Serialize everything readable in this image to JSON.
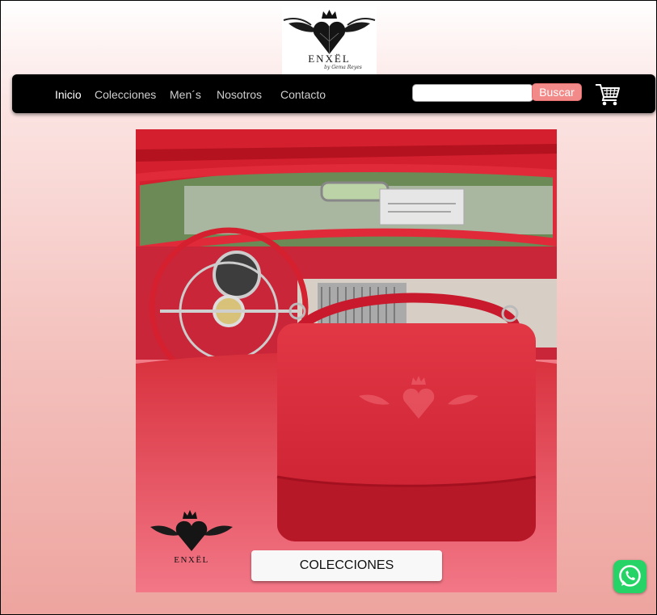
{
  "brand": {
    "name": "ENXËL",
    "signature": "by Gema Reyes"
  },
  "nav": {
    "items": [
      {
        "label": "Inicio",
        "active": true
      },
      {
        "label": "Colecciones",
        "active": false
      },
      {
        "label": "Men´s",
        "active": false
      },
      {
        "label": "Nosotros",
        "active": false
      },
      {
        "label": "Contacto",
        "active": false
      }
    ]
  },
  "search": {
    "value": "",
    "placeholder": "",
    "button_label": "Buscar"
  },
  "hero": {
    "cta_label": "COLECCIONES"
  },
  "icons": {
    "cart": "shopping-cart-icon",
    "whatsapp": "whatsapp-icon"
  },
  "colors": {
    "navbar": "#000000",
    "search_button": "#f28a8a",
    "whatsapp": "#25d366"
  }
}
